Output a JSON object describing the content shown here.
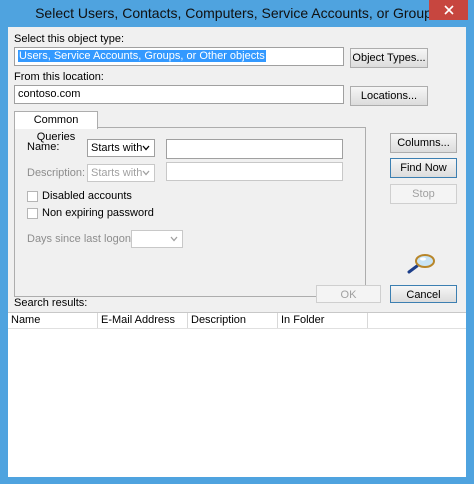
{
  "window": {
    "title": "Select Users, Contacts, Computers, Service Accounts, or Groups"
  },
  "object_type": {
    "label": "Select this object type:",
    "value": "Users, Service Accounts, Groups, or Other objects",
    "button": "Object Types..."
  },
  "location": {
    "label": "From this location:",
    "value": "contoso.com",
    "button": "Locations..."
  },
  "tab": {
    "label": "Common Queries"
  },
  "queries": {
    "name_label": "Name:",
    "name_mode": "Starts with",
    "description_label": "Description:",
    "description_mode": "Starts with",
    "disabled_accounts": "Disabled accounts",
    "non_expiring_password": "Non expiring password",
    "days_label": "Days since last logon:"
  },
  "buttons": {
    "columns": "Columns...",
    "find_now": "Find Now",
    "stop": "Stop",
    "ok": "OK",
    "cancel": "Cancel"
  },
  "results": {
    "label": "Search results:",
    "columns": [
      "Name",
      "E-Mail Address",
      "Description",
      "In Folder"
    ]
  },
  "icons": {
    "close": "close-icon",
    "search": "magnifier-icon",
    "dropdown": "chevron-down-icon"
  },
  "colors": {
    "titlebar": "#4fa3df",
    "close": "#c7463f",
    "selection": "#3399ff"
  }
}
